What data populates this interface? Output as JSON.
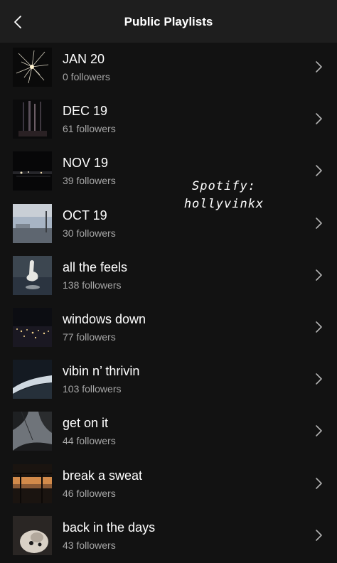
{
  "header": {
    "title": "Public Playlists"
  },
  "icons": {
    "back": "back-arrow-icon",
    "row": "chevron-right-icon"
  },
  "playlists": [
    {
      "title": "JAN 20",
      "followers": "0 followers"
    },
    {
      "title": "DEC 19",
      "followers": "61 followers"
    },
    {
      "title": "NOV 19",
      "followers": "39 followers"
    },
    {
      "title": "OCT 19",
      "followers": "30 followers"
    },
    {
      "title": "all the feels",
      "followers": "138 followers"
    },
    {
      "title": "windows down",
      "followers": "77 followers"
    },
    {
      "title": "vibin n’ thrivin",
      "followers": "103 followers"
    },
    {
      "title": "get on it",
      "followers": "44 followers"
    },
    {
      "title": "break a sweat",
      "followers": "46 followers"
    },
    {
      "title": "back in the days",
      "followers": "43 followers"
    }
  ],
  "overlay": {
    "line1": "Spotify:",
    "line2": "hollyvinkx"
  },
  "colors": {
    "background": "#121212",
    "header": "#1e1e1e",
    "secondary_text": "#a7a7a7"
  }
}
